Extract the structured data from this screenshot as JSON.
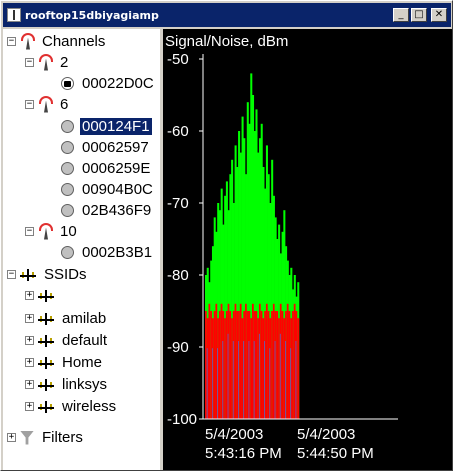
{
  "window": {
    "title": "rooftop15dbiyagiamp"
  },
  "tree": {
    "channels_label": "Channels",
    "channels": [
      {
        "label": "2",
        "aps": [
          {
            "label": "00022D0C",
            "state": "locked",
            "selected": false
          }
        ]
      },
      {
        "label": "6",
        "aps": [
          {
            "label": "000124F1",
            "state": "normal",
            "selected": true
          },
          {
            "label": "00062597",
            "state": "normal",
            "selected": false
          },
          {
            "label": "0006259E",
            "state": "normal",
            "selected": false
          },
          {
            "label": "00904B0C",
            "state": "normal",
            "selected": false
          },
          {
            "label": "02B436F9",
            "state": "normal",
            "selected": false
          }
        ]
      },
      {
        "label": "10",
        "aps": [
          {
            "label": "0002B3B1",
            "state": "normal",
            "selected": false
          }
        ]
      }
    ],
    "ssids_label": "SSIDs",
    "ssids": [
      "",
      "amilab",
      "default",
      "Home",
      "linksys",
      "wireless"
    ],
    "filters_label": "Filters"
  },
  "chart_data": {
    "type": "bar",
    "title": "",
    "ylabel": "Signal/Noise, dBm",
    "ylim": [
      -100,
      -50
    ],
    "yticks": [
      "-50",
      "-60",
      "-70",
      "-80",
      "-90",
      "-100"
    ],
    "xticks": [
      {
        "date": "5/4/2003",
        "time": "5:43:16 PM"
      },
      {
        "date": "5/4/2003",
        "time": "5:44:50 PM"
      }
    ],
    "series": [
      {
        "role": "signal",
        "color": "#00ff00"
      },
      {
        "role": "noise",
        "color": "#ff0000"
      }
    ],
    "signal_dbm": [
      -80,
      -79,
      -81,
      -78,
      -76,
      -72,
      -74,
      -70,
      -71,
      -68,
      -73,
      -69,
      -67,
      -71,
      -66,
      -64,
      -70,
      -62,
      -65,
      -60,
      -63,
      -58,
      -61,
      -66,
      -56,
      -59,
      -52,
      -55,
      -60,
      -57,
      -63,
      -61,
      -59,
      -65,
      -68,
      -62,
      -66,
      -70,
      -64,
      -69,
      -72,
      -75,
      -73,
      -77,
      -74,
      -71,
      -76,
      -78,
      -80,
      -79,
      -82,
      -80,
      -83,
      -81
    ],
    "noise_dbm": [
      -85,
      -86,
      -84,
      -85,
      -86,
      -85,
      -84,
      -86,
      -85,
      -84,
      -85,
      -86,
      -85,
      -84,
      -85,
      -86,
      -85,
      -84,
      -85,
      -85,
      -84,
      -86,
      -85,
      -84,
      -85,
      -85,
      -86,
      -84,
      -85,
      -85,
      -86,
      -84,
      -85,
      -86,
      -85,
      -84,
      -85,
      -86,
      -85,
      -84,
      -85,
      -85,
      -86,
      -84,
      -85,
      -86,
      -85,
      -84,
      -85,
      -86,
      -85,
      -84,
      -85,
      -86
    ]
  },
  "colors": {
    "selection": "#0a246a",
    "plot_bg": "#000000",
    "axis": "#ffffff"
  }
}
